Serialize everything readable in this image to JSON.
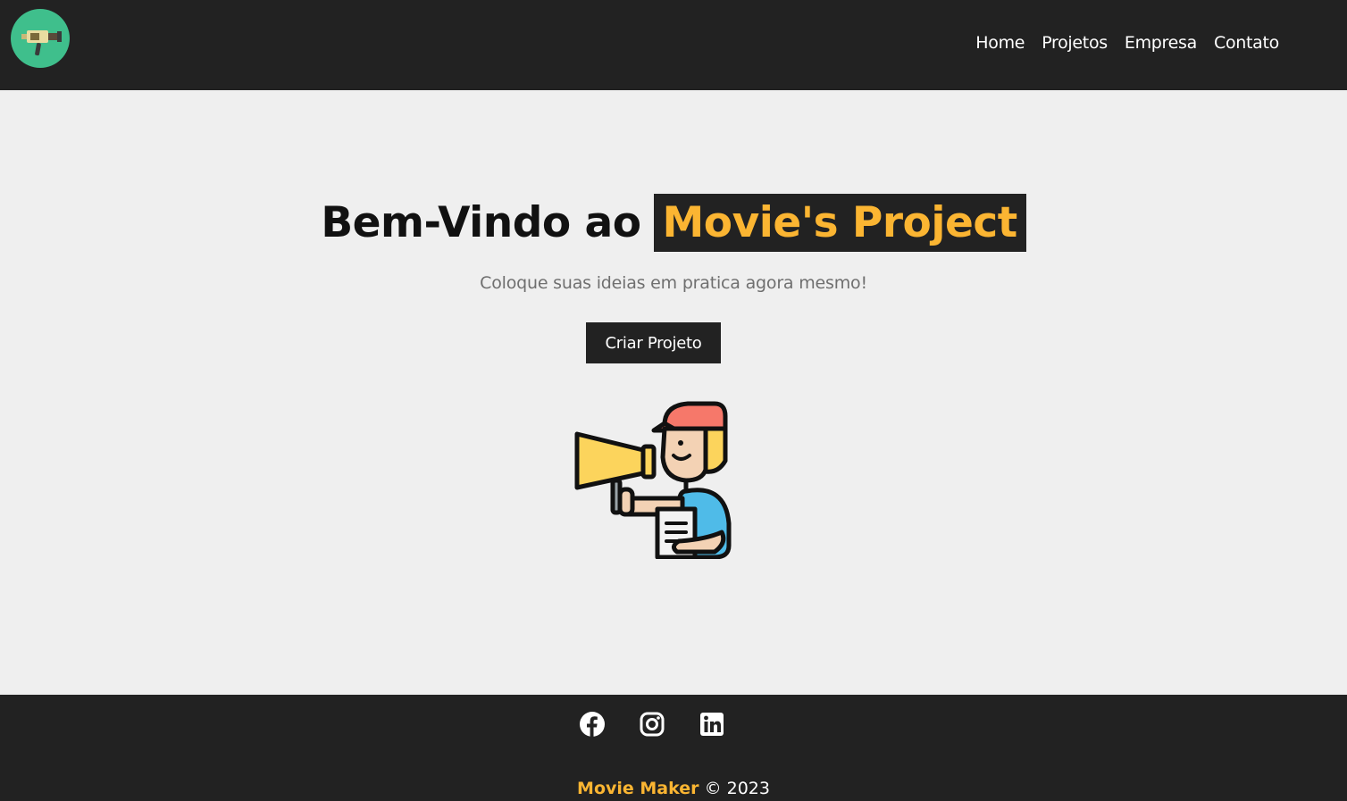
{
  "navbar": {
    "logo_icon": "video-camera-icon",
    "links": [
      {
        "label": "Home"
      },
      {
        "label": "Projetos"
      },
      {
        "label": "Empresa"
      },
      {
        "label": "Contato"
      }
    ]
  },
  "hero": {
    "title_prefix": "Bem-Vindo ao",
    "title_highlight": "Movie's Project",
    "subtitle": "Coloque suas ideias em pratica agora mesmo!",
    "cta_label": "Criar Projeto",
    "illustration_icon": "director-megaphone-icon"
  },
  "footer": {
    "social_icons": [
      "facebook-icon",
      "instagram-icon",
      "linkedin-icon"
    ],
    "brand": "Movie Maker",
    "copyright": "© 2023"
  },
  "colors": {
    "dark": "#222222",
    "accent": "#fbb532",
    "background": "#efefef",
    "logo_bg": "#3fbf8c"
  }
}
